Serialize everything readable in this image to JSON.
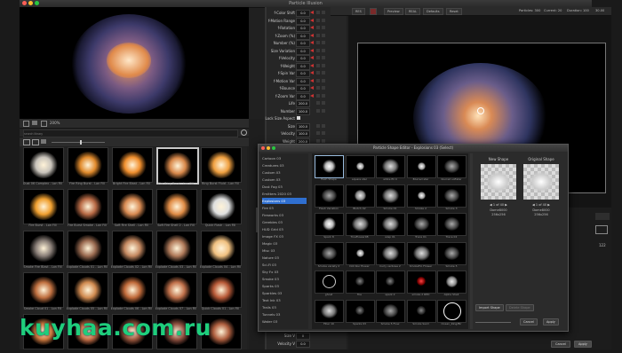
{
  "window": {
    "title": "Particle Illusion"
  },
  "left_browser": {
    "size_label": "200%",
    "search_placeholder": "search library",
    "thumbnails": [
      {
        "label": "Dust 06 Complex - Lon Fill",
        "color": "#c8c3bb"
      },
      {
        "label": "Fire Ring Burst - Lon Fill",
        "color": "#e08a2c"
      },
      {
        "label": "Bright Fire Blast - Lon Fill",
        "color": "#f08f2e"
      },
      {
        "label": "Fire Ring Burst - Lon Fill",
        "color": "#d8884a",
        "selected": true
      },
      {
        "label": "Ring Burst Fluid - Lon Fill",
        "color": "#f0a040"
      },
      {
        "label": "Fire Burst - Lon Fill",
        "color": "#f0a030"
      },
      {
        "label": "Fire Burst Smoke - Lon Fill",
        "color": "#b86a45"
      },
      {
        "label": "Soft Fire Shell - Lon Fill",
        "color": "#d88a52"
      },
      {
        "label": "Soft Fire Shell 2 - Lon Fill",
        "color": "#e08c46"
      },
      {
        "label": "Quick Flash - Lon Fill",
        "color": "#dfe0e0"
      },
      {
        "label": "Smoke Fire Blast - Lon Fill",
        "color": "#8a7f78"
      },
      {
        "label": "Explode Clouds 01 - Lon Fill",
        "color": "#9a6a50"
      },
      {
        "label": "Explode Clouds 02 - Lon Fill",
        "color": "#c48860"
      },
      {
        "label": "Explode Clouds 03 - Lon Fill",
        "color": "#b07a5a"
      },
      {
        "label": "Explode Clouds 04 - Lon Fill",
        "color": "#f0c080"
      },
      {
        "label": "Smoke Cloud 01 - Lon Fill",
        "color": "#c07040"
      },
      {
        "label": "Explode Clouds 05 - Lon Fill",
        "color": "#d08a50"
      },
      {
        "label": "Explode Clouds 06 - Lon Fill",
        "color": "#c06a3a"
      },
      {
        "label": "Explode Clouds 07 - Lon Fill",
        "color": "#c0704a"
      },
      {
        "label": "Quick Clouds 01 - Lon Fill",
        "color": "#b85a38"
      },
      {
        "label": "",
        "color": "#d07a40"
      },
      {
        "label": "",
        "color": "#c87048"
      },
      {
        "label": "",
        "color": "#a05a40"
      },
      {
        "label": "",
        "color": "#905040"
      },
      {
        "label": "",
        "color": "#b06040"
      }
    ]
  },
  "properties": [
    {
      "label": "f-Color Shift",
      "value": "0.0"
    },
    {
      "label": "f-Motion Range",
      "value": "0.0"
    },
    {
      "label": "f-Rotation",
      "value": "0.0"
    },
    {
      "label": "f-Zoom (%)",
      "value": "0.0"
    },
    {
      "label": "Number (%)",
      "value": "0.0"
    },
    {
      "label": "Size Variation",
      "value": "0.0"
    },
    {
      "label": "f-Velocity",
      "value": "0.0"
    },
    {
      "label": "f-Weight",
      "value": "0.0"
    },
    {
      "label": "f-Spin Var",
      "value": "0.0"
    },
    {
      "label": "f-Motion Var",
      "value": "0.0"
    },
    {
      "label": "f-Bounce",
      "value": "0.0"
    },
    {
      "label": "f-Zoom Var",
      "value": "0.0"
    },
    {
      "label": "Life",
      "value": "200.0"
    },
    {
      "label": "Number",
      "value": "100.0"
    },
    {
      "label": "Lock Size Aspect",
      "value": ""
    },
    {
      "label": "Size",
      "value": "100.0"
    },
    {
      "label": "Velocity",
      "value": "100.0"
    },
    {
      "label": "Weight",
      "value": "200.0"
    },
    {
      "label": "Spin",
      "value": "100.0"
    },
    {
      "label": "Motion Rand",
      "value": "100.0"
    }
  ],
  "properties_bottom": [
    {
      "label": "Size V",
      "value": "0"
    },
    {
      "label": "Velocity V",
      "value": "0.0"
    }
  ],
  "viewer_bar": {
    "buttons": [
      "RES",
      "Preview",
      "REAL",
      "Defaults",
      "Reset"
    ],
    "particles": "Particles: 300",
    "current": "Current: 20",
    "duration": "Duration: 100",
    "fps": "30.00"
  },
  "viewer_bottom": {
    "cancel": "Cancel",
    "apply": "Apply",
    "side_value": "122"
  },
  "dialog": {
    "title": "Particle Shape Editor - Explosions 03 (Select)",
    "categories": [
      "Cartoon 03",
      "Creatures 03",
      "Custom 03",
      "Custom 03",
      "Dust Fog 03",
      "Emitters 2020 03",
      "Explosions 03",
      "Fire 03",
      "Fireworks 03",
      "Greebles 03",
      "HUD Grid 03",
      "Image FX 03",
      "Magic 03",
      "Misc 03",
      "Nature 03",
      "Sci-Fi 03",
      "Sky Fx 03",
      "Smoke 03",
      "Sparks 03",
      "Sparkles 03",
      "Text Ink 03",
      "Trails 03",
      "Tunnels 03",
      "Water 03"
    ],
    "selected_category": "Explosions 03",
    "shapes": [
      {
        "label": "flash Shape",
        "kind": "flash",
        "selected": true
      },
      {
        "label": "square star",
        "kind": "dot"
      },
      {
        "label": "white fill 0",
        "kind": "cloud"
      },
      {
        "label": "Blurred star",
        "kind": "dot"
      },
      {
        "label": "blurred softstar",
        "kind": "soft"
      },
      {
        "label": "Flash Variation",
        "kind": "soft"
      },
      {
        "label": "Blotch 02",
        "kind": "blob"
      },
      {
        "label": "Smoke 01",
        "kind": "cloud"
      },
      {
        "label": "Smoke 2",
        "kind": "dot"
      },
      {
        "label": "Smoke 3",
        "kind": "soft"
      },
      {
        "label": "Spark 8",
        "kind": "flash"
      },
      {
        "label": "TinaFlower08",
        "kind": "cloud"
      },
      {
        "label": "wisp 01",
        "kind": "cloud"
      },
      {
        "label": "Trace 01",
        "kind": "soft"
      },
      {
        "label": "Trace 02",
        "kind": "soft"
      },
      {
        "label": "Smoke variety 2",
        "kind": "soft"
      },
      {
        "label": "Dot blur flower",
        "kind": "dot"
      },
      {
        "label": "Curly verbose 2",
        "kind": "cloud"
      },
      {
        "label": "SmokeFlo Flower",
        "kind": "cloud"
      },
      {
        "label": "Smoke 5",
        "kind": "soft"
      },
      {
        "label": "ghost",
        "kind": "ring"
      },
      {
        "label": "fire",
        "kind": "sparks"
      },
      {
        "label": "spark 2",
        "kind": "sparks"
      },
      {
        "label": "smoke 2 RED",
        "kind": "red"
      },
      {
        "label": "Alpha Shell",
        "kind": "blob"
      },
      {
        "label": "Filler 10",
        "kind": "cloud"
      },
      {
        "label": "Sparks 03",
        "kind": "sparks"
      },
      {
        "label": "Smoke 5 Flow",
        "kind": "soft"
      },
      {
        "label": "Smoke Swirl",
        "kind": "sparks"
      },
      {
        "label": "Ocean_Ring/Blr",
        "kind": "bigring"
      }
    ],
    "new_shape": {
      "title": "New Shape",
      "nav": "1 of 40",
      "name": "Dome8000",
      "size": "256x256"
    },
    "original_shape": {
      "title": "Original Shape",
      "nav": "1 of 40",
      "name": "Dome8000",
      "size": "256x256"
    },
    "import_button": "Import Shape",
    "delete_button": "Delete Shape",
    "cancel_button": "Cancel",
    "apply_button": "Apply"
  },
  "watermark": "kuyhaa.com.ru",
  "colors": {
    "accent": "#2f6fd0",
    "watermark": "#1fce7c"
  }
}
